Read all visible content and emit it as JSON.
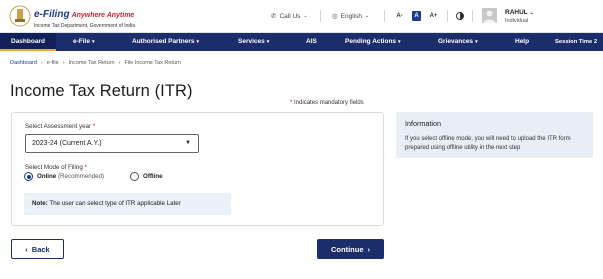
{
  "header": {
    "brand_main": "e-Filing",
    "brand_tag": "Anywhere Anytime",
    "brand_sub": "Income Tax Department, Government of India",
    "call_us": "Call Us",
    "language": "English",
    "font_decrease": "A-",
    "font_normal": "A",
    "font_increase": "A+",
    "user_name": "RAHUL",
    "user_role": "Individual"
  },
  "nav": {
    "items": [
      {
        "label": "Dashboard"
      },
      {
        "label": "e-File"
      },
      {
        "label": "Authorised Partners"
      },
      {
        "label": "Services"
      },
      {
        "label": "AIS"
      },
      {
        "label": "Pending Actions"
      },
      {
        "label": "Grievances"
      },
      {
        "label": "Help"
      },
      {
        "label": "Session Time 2"
      }
    ]
  },
  "breadcrumb": [
    "Dashboard",
    "e-file",
    "Income Tax Return",
    "File Income Tax Return"
  ],
  "page": {
    "title": "Income Tax Return (ITR)",
    "mandatory_star": "*",
    "mandatory_text": "Indicates mandatory fields"
  },
  "form": {
    "assessment_year_label": "Select Assessment year",
    "assessment_year_value": "2023-24 (Current A.Y.)",
    "mode_label": "Select Mode of Filing",
    "required_mark": "*",
    "online_label": "Online",
    "online_hint": "(Recommended)",
    "offline_label": "Offline",
    "note_label": "Note:",
    "note_text": "The user can select type of ITR applicable Later"
  },
  "info": {
    "title": "Information",
    "body": "If you select offline mode, you will need to upload the ITR form prepared using offline utility in the next step"
  },
  "buttons": {
    "back": "Back",
    "continue": "Continue"
  },
  "colors": {
    "nav_bg": "#1c2d6b",
    "accent": "#f5a623",
    "info_bg": "#e8eef6",
    "required": "#d0021b"
  }
}
